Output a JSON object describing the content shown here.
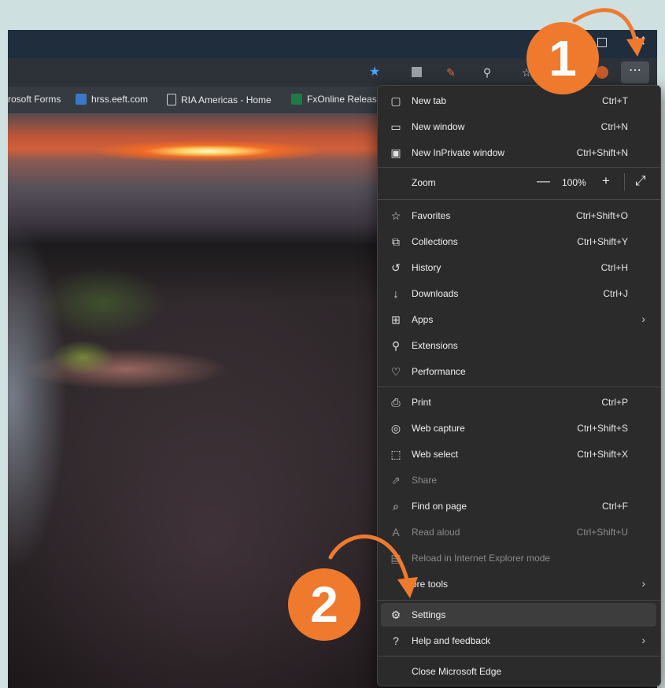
{
  "bookmarks": [
    {
      "label": "rosoft Forms",
      "icon": "forms-icon"
    },
    {
      "label": "hrss.eeft.com",
      "icon": "page-blue-icon"
    },
    {
      "label": "RIA Americas - Home",
      "icon": "page-icon"
    },
    {
      "label": "FxOnline Releas",
      "icon": "excel-icon"
    }
  ],
  "menu": {
    "items_top": [
      {
        "label": "New tab",
        "shortcut": "Ctrl+T",
        "icon": "new-tab-icon"
      },
      {
        "label": "New window",
        "shortcut": "Ctrl+N",
        "icon": "new-window-icon"
      },
      {
        "label": "New InPrivate window",
        "shortcut": "Ctrl+Shift+N",
        "icon": "inprivate-icon"
      }
    ],
    "zoom": {
      "label": "Zoom",
      "minus": "—",
      "value": "100%",
      "plus": "+",
      "fullscreen": "⤢"
    },
    "items_mid": [
      {
        "label": "Favorites",
        "shortcut": "Ctrl+Shift+O",
        "icon": "favorites-icon"
      },
      {
        "label": "Collections",
        "shortcut": "Ctrl+Shift+Y",
        "icon": "collections-icon"
      },
      {
        "label": "History",
        "shortcut": "Ctrl+H",
        "icon": "history-icon"
      },
      {
        "label": "Downloads",
        "shortcut": "Ctrl+J",
        "icon": "downloads-icon"
      },
      {
        "label": "Apps",
        "shortcut": "",
        "icon": "apps-icon",
        "submenu": true
      },
      {
        "label": "Extensions",
        "shortcut": "",
        "icon": "extensions-icon"
      },
      {
        "label": "Performance",
        "shortcut": "",
        "icon": "performance-icon"
      }
    ],
    "items_bottom": [
      {
        "label": "Print",
        "shortcut": "Ctrl+P",
        "icon": "print-icon"
      },
      {
        "label": "Web capture",
        "shortcut": "Ctrl+Shift+S",
        "icon": "web-capture-icon"
      },
      {
        "label": "Web select",
        "shortcut": "Ctrl+Shift+X",
        "icon": "web-select-icon"
      },
      {
        "label": "Share",
        "shortcut": "",
        "icon": "share-icon",
        "disabled": true
      },
      {
        "label": "Find on page",
        "shortcut": "Ctrl+F",
        "icon": "find-icon"
      },
      {
        "label": "Read aloud",
        "shortcut": "Ctrl+Shift+U",
        "icon": "read-aloud-icon",
        "disabled": true
      },
      {
        "label": "Reload in Internet Explorer mode",
        "shortcut": "",
        "icon": "ie-mode-icon",
        "disabled": true
      },
      {
        "label": "ore tools",
        "shortcut": "",
        "icon": "more-tools-icon",
        "submenu": true
      },
      {
        "label": "Settings",
        "shortcut": "",
        "icon": "settings-icon",
        "highlighted": true
      },
      {
        "label": "Help and feedback",
        "shortcut": "",
        "icon": "help-icon",
        "submenu": true
      }
    ],
    "close": {
      "label": "Close Microsoft Edge"
    }
  },
  "callouts": {
    "step1": "1",
    "step2": "2"
  },
  "colors": {
    "accent": "#ef7a2e",
    "menu_bg": "#2b2b2b",
    "favorite_star": "#4aa3ff"
  }
}
